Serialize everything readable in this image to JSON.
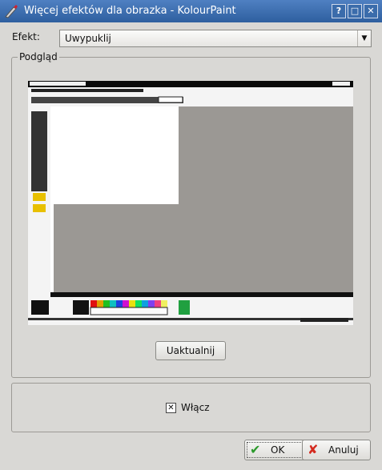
{
  "window": {
    "title": "Więcej efektów dla obrazka - KolourPaint"
  },
  "titlebar_buttons": {
    "help": "?",
    "maximize": "□",
    "close": "✕"
  },
  "effect": {
    "label": "Efekt:",
    "selected": "Uwypuklij"
  },
  "preview_group": {
    "title": "Podgląd"
  },
  "refresh_label": "Uaktualnij",
  "enable": {
    "label": "Włącz",
    "checked": true
  },
  "buttons": {
    "ok": "OK",
    "cancel": "Anuluj"
  }
}
